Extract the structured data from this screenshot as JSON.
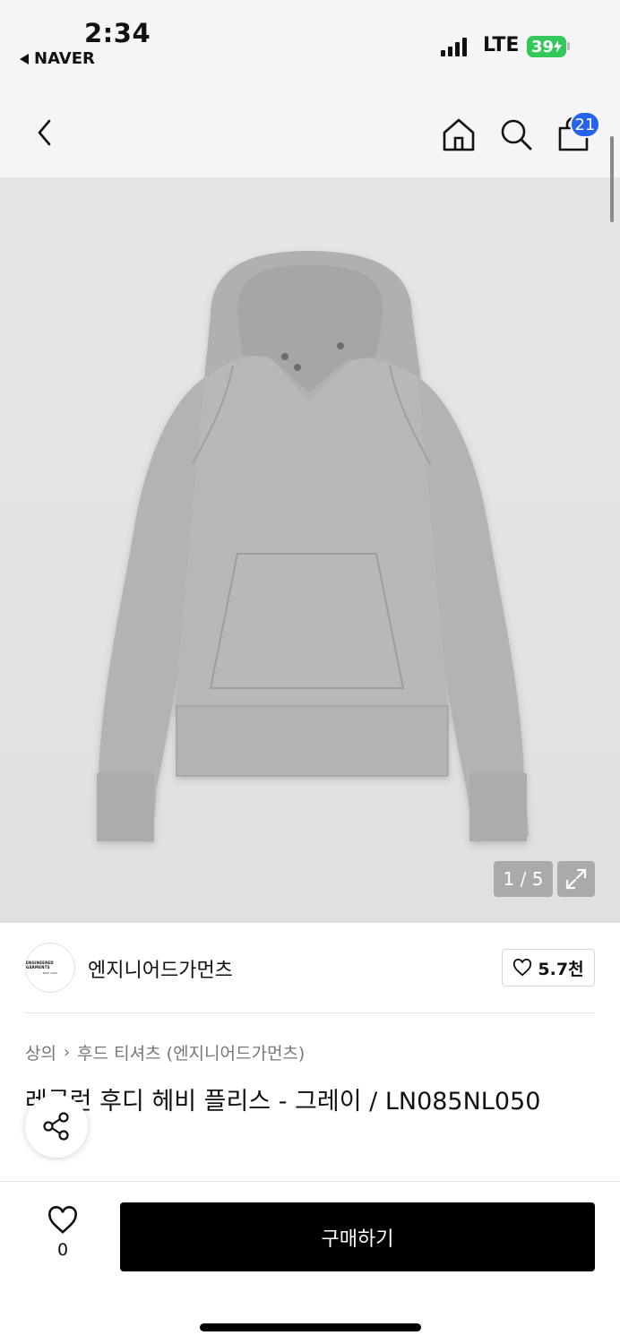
{
  "status_bar": {
    "time": "2:34",
    "back_app": "NAVER",
    "network": "LTE",
    "battery": "39"
  },
  "header": {
    "cart_count": "21"
  },
  "gallery": {
    "counter": "1 / 5"
  },
  "brand": {
    "name": "엔지니어드가먼츠",
    "logo_text": "ENGINEERED GARMENTS",
    "logo_subtext": "NEW YORK",
    "like_count": "5.7천"
  },
  "product": {
    "breadcrumb": [
      "상의",
      "후드 티셔츠 (엔지니어드가먼츠)"
    ],
    "title": "레글런 후디 헤비 플리스 - 그레이 / LN085NL050"
  },
  "bottom": {
    "wish_count": "0",
    "buy_label": "구매하기"
  },
  "colors": {
    "accent_badge": "#2563eb",
    "battery": "#34c759",
    "buy_button": "#000000"
  },
  "icons": {
    "back": "chevron-left-icon",
    "home": "home-icon",
    "search": "search-icon",
    "cart": "shopping-bag-icon",
    "expand": "expand-icon",
    "heart": "heart-icon",
    "share": "share-icon"
  }
}
